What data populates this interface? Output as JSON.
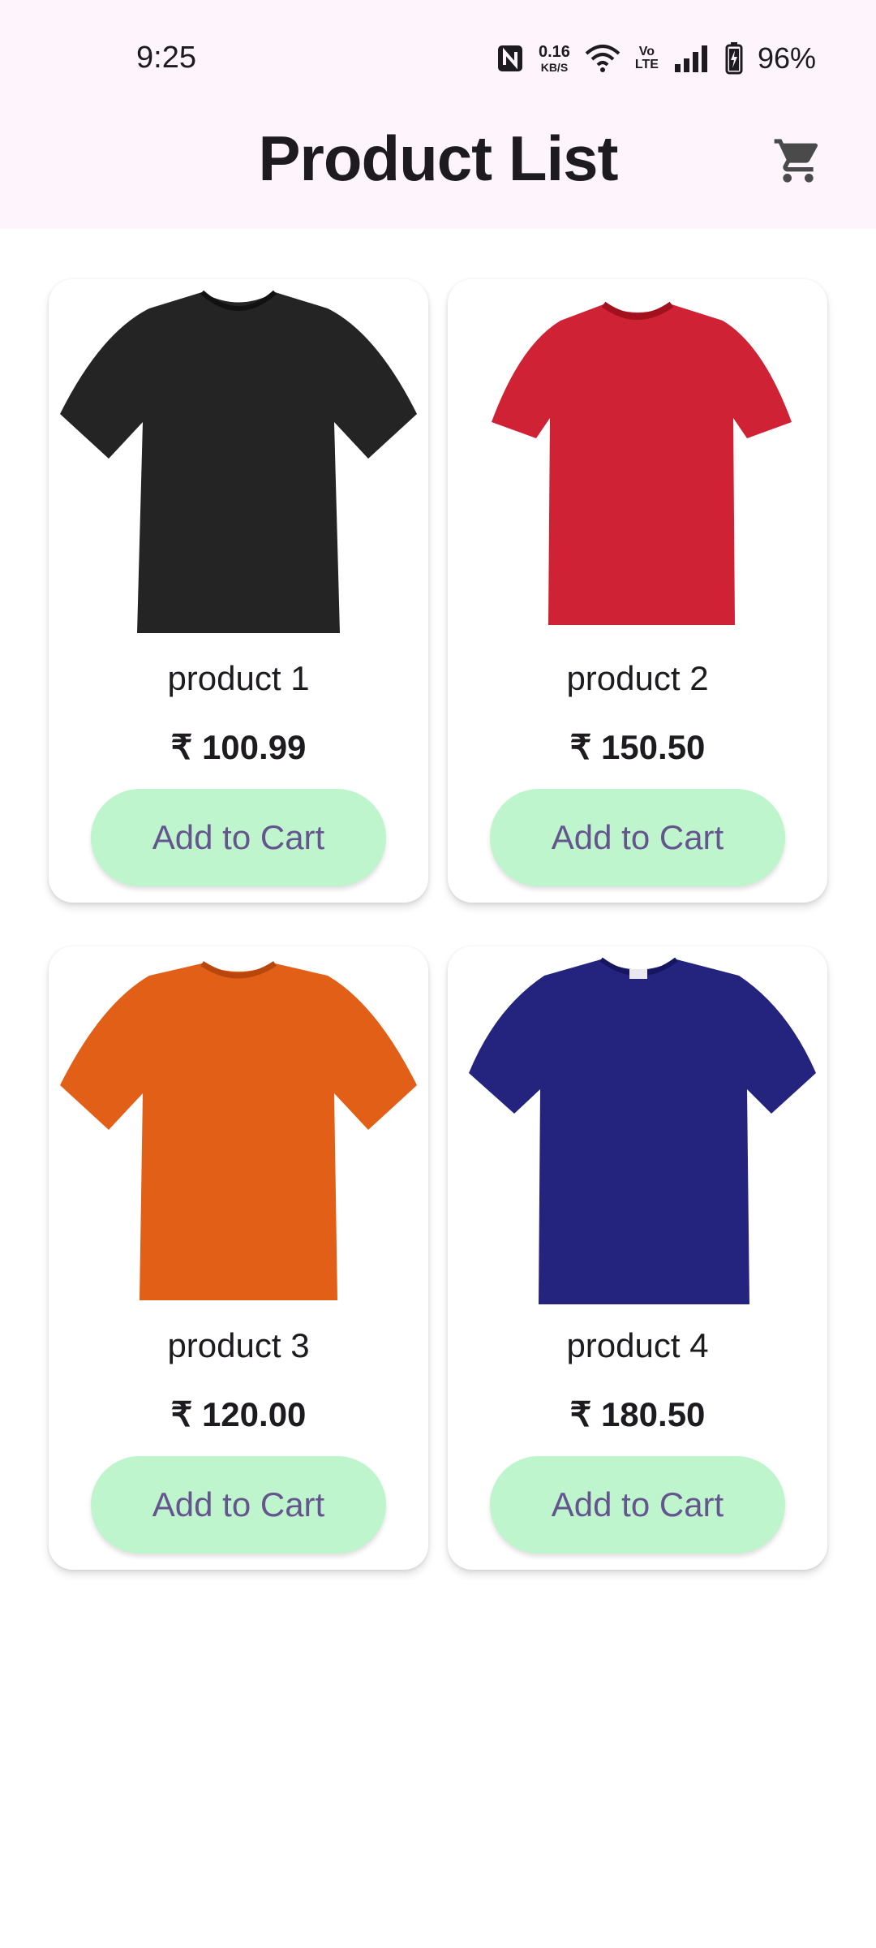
{
  "status_bar": {
    "time": "9:25",
    "net_speed_value": "0.16",
    "net_speed_unit": "KB/S",
    "volte_top": "Vo",
    "volte_bottom": "LTE",
    "battery_text": "96%",
    "icons": [
      "nfc-icon",
      "wifi-icon",
      "signal-icon",
      "battery-icon"
    ]
  },
  "header": {
    "title": "Product List",
    "cart_icon": "shopping-cart-icon"
  },
  "products": [
    {
      "name": "product 1",
      "price": "₹ 100.99",
      "button_label": "Add to Cart",
      "shirt_color": "#242424"
    },
    {
      "name": "product 2",
      "price": "₹ 150.50",
      "button_label": "Add to Cart",
      "shirt_color": "#cf2234"
    },
    {
      "name": "product 3",
      "price": "₹ 120.00",
      "button_label": "Add to Cart",
      "shirt_color": "#e25f17"
    },
    {
      "name": "product 4",
      "price": "₹ 180.50",
      "button_label": "Add to Cart",
      "shirt_color": "#24247e"
    }
  ],
  "colors": {
    "app_bar_bg": "#fdf5fb",
    "button_bg": "#bff5cc",
    "button_text": "#65558f"
  }
}
